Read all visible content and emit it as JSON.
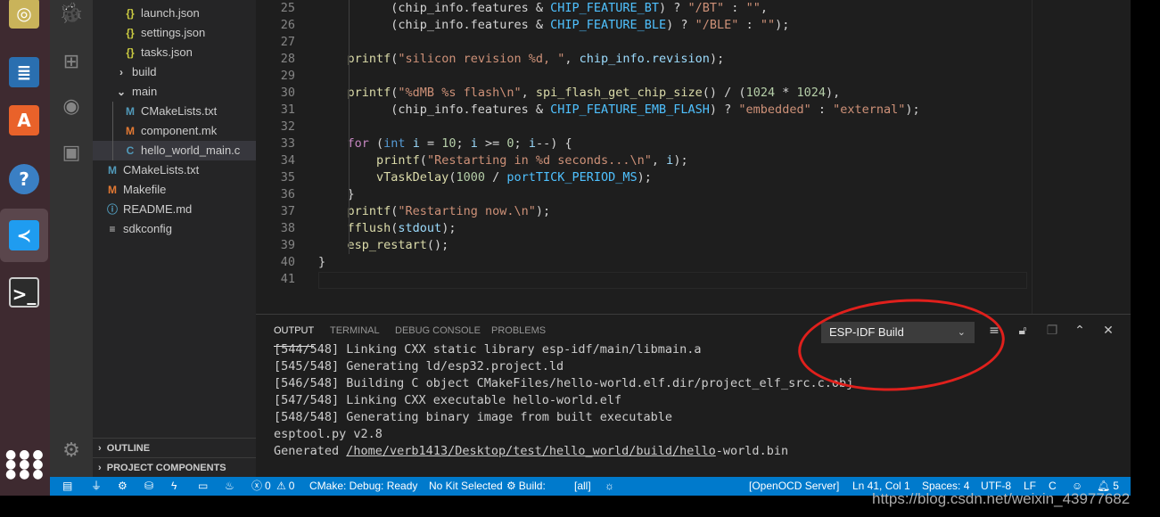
{
  "dock": [
    {
      "name": "rhythmbox-icon",
      "color": "#c9b35a"
    },
    {
      "name": "libreoffice-writer-icon",
      "color": "#2a6fb0"
    },
    {
      "name": "software-center-icon",
      "color": "#e9622a"
    },
    {
      "name": "help-icon",
      "color": "#3a7fc4"
    },
    {
      "name": "vscode-icon",
      "color": "#1f9cf0"
    },
    {
      "name": "terminal-icon",
      "color": "#2c2c2c"
    }
  ],
  "activity": [
    {
      "name": "debug-icon",
      "glyph": "🐞"
    },
    {
      "name": "extensions-icon",
      "glyph": "⊞"
    },
    {
      "name": "espressif-icon",
      "glyph": "◉"
    },
    {
      "name": "remote-explorer-icon",
      "glyph": "▣"
    }
  ],
  "explorer": [
    {
      "label": "launch.json",
      "icon": "{}",
      "color": "#cbcb41",
      "indent": 1
    },
    {
      "label": "settings.json",
      "icon": "{}",
      "color": "#cbcb41",
      "indent": 1
    },
    {
      "label": "tasks.json",
      "icon": "{}",
      "color": "#cbcb41",
      "indent": 1
    },
    {
      "label": "build",
      "icon": "›",
      "color": "#cccccc",
      "indent": 0.5
    },
    {
      "label": "main",
      "icon": "⌄",
      "color": "#cccccc",
      "indent": 0.5
    },
    {
      "label": "CMakeLists.txt",
      "icon": "M",
      "color": "#519aba",
      "indent": 1
    },
    {
      "label": "component.mk",
      "icon": "M",
      "color": "#e37933",
      "indent": 1
    },
    {
      "label": "hello_world_main.c",
      "icon": "C",
      "color": "#519aba",
      "indent": 1,
      "selected": true
    },
    {
      "label": "CMakeLists.txt",
      "icon": "M",
      "color": "#519aba",
      "indent": 0
    },
    {
      "label": "Makefile",
      "icon": "M",
      "color": "#e37933",
      "indent": 0
    },
    {
      "label": "README.md",
      "icon": "ⓘ",
      "color": "#519aba",
      "indent": 0
    },
    {
      "label": "sdkconfig",
      "icon": "≡",
      "color": "#cccccc",
      "indent": 0
    }
  ],
  "sections": {
    "outline": "OUTLINE",
    "project_components": "PROJECT COMPONENTS"
  },
  "editor": {
    "lines": [
      {
        "n": "25",
        "t": [
          [
            "p",
            "          (chip_info.features & "
          ],
          [
            "c",
            "CHIP_FEATURE_BT"
          ],
          [
            "p",
            ") ? "
          ],
          [
            "s",
            "\"/BT\""
          ],
          [
            "p",
            " : "
          ],
          [
            "s",
            "\"\""
          ],
          [
            "p",
            ","
          ]
        ]
      },
      {
        "n": "26",
        "t": [
          [
            "p",
            "          (chip_info.features & "
          ],
          [
            "c",
            "CHIP_FEATURE_BLE"
          ],
          [
            "p",
            ") ? "
          ],
          [
            "s",
            "\"/BLE\""
          ],
          [
            "p",
            " : "
          ],
          [
            "s",
            "\"\""
          ],
          [
            "p",
            ");"
          ]
        ]
      },
      {
        "n": "27",
        "t": []
      },
      {
        "n": "28",
        "t": [
          [
            "f",
            "    printf"
          ],
          [
            "p",
            "("
          ],
          [
            "s",
            "\"silicon revision %d, \""
          ],
          [
            "p",
            ", "
          ],
          [
            "v",
            "chip_info.revision"
          ],
          [
            "p",
            ");"
          ]
        ]
      },
      {
        "n": "29",
        "t": []
      },
      {
        "n": "30",
        "t": [
          [
            "f",
            "    printf"
          ],
          [
            "p",
            "("
          ],
          [
            "s",
            "\"%dMB %s flash\\n\""
          ],
          [
            "p",
            ", "
          ],
          [
            "f",
            "spi_flash_get_chip_size"
          ],
          [
            "p",
            "() / ("
          ],
          [
            "n",
            "1024"
          ],
          [
            "p",
            " * "
          ],
          [
            "n",
            "1024"
          ],
          [
            "p",
            "),"
          ]
        ]
      },
      {
        "n": "31",
        "t": [
          [
            "p",
            "          (chip_info.features & "
          ],
          [
            "c",
            "CHIP_FEATURE_EMB_FLASH"
          ],
          [
            "p",
            ") ? "
          ],
          [
            "s",
            "\"embedded\""
          ],
          [
            "p",
            " : "
          ],
          [
            "s",
            "\"external\""
          ],
          [
            "p",
            ");"
          ]
        ]
      },
      {
        "n": "32",
        "t": []
      },
      {
        "n": "33",
        "t": [
          [
            "k",
            "    for"
          ],
          [
            "p",
            " ("
          ],
          [
            "t",
            "int"
          ],
          [
            "v",
            " i"
          ],
          [
            "p",
            " = "
          ],
          [
            "n",
            "10"
          ],
          [
            "p",
            "; "
          ],
          [
            "v",
            "i"
          ],
          [
            "p",
            " >= "
          ],
          [
            "n",
            "0"
          ],
          [
            "p",
            "; "
          ],
          [
            "v",
            "i"
          ],
          [
            "p",
            "--) {"
          ]
        ]
      },
      {
        "n": "34",
        "t": [
          [
            "f",
            "        printf"
          ],
          [
            "p",
            "("
          ],
          [
            "s",
            "\"Restarting in %d seconds...\\n\""
          ],
          [
            "p",
            ", "
          ],
          [
            "v",
            "i"
          ],
          [
            "p",
            ");"
          ]
        ]
      },
      {
        "n": "35",
        "t": [
          [
            "f",
            "        vTaskDelay"
          ],
          [
            "p",
            "("
          ],
          [
            "n",
            "1000"
          ],
          [
            "p",
            " / "
          ],
          [
            "c",
            "portTICK_PERIOD_MS"
          ],
          [
            "p",
            ");"
          ]
        ]
      },
      {
        "n": "36",
        "t": [
          [
            "p",
            "    }"
          ]
        ]
      },
      {
        "n": "37",
        "t": [
          [
            "f",
            "    printf"
          ],
          [
            "p",
            "("
          ],
          [
            "s",
            "\"Restarting now.\\n\""
          ],
          [
            "p",
            ");"
          ]
        ]
      },
      {
        "n": "38",
        "t": [
          [
            "f",
            "    fflush"
          ],
          [
            "p",
            "("
          ],
          [
            "v",
            "stdout"
          ],
          [
            "p",
            ");"
          ]
        ]
      },
      {
        "n": "39",
        "t": [
          [
            "f",
            "    esp_restart"
          ],
          [
            "p",
            "();"
          ]
        ]
      },
      {
        "n": "40",
        "t": [
          [
            "p",
            "}"
          ]
        ]
      },
      {
        "n": "41",
        "t": []
      }
    ]
  },
  "colors": {
    "p": "#d4d4d4",
    "v": "#9cdcfe",
    "c": "#4fc1ff",
    "s": "#ce9178",
    "f": "#dcdcaa",
    "k": "#c586c0",
    "t": "#569cd6",
    "n": "#b5cea8"
  },
  "panel": {
    "tabs": [
      "OUTPUT",
      "TERMINAL",
      "DEBUG CONSOLE",
      "PROBLEMS"
    ],
    "channel": "ESP-IDF Build",
    "output": [
      "[544/548] Linking CXX static library esp-idf/main/libmain.a",
      "[545/548] Generating ld/esp32.project.ld",
      "[546/548] Building C object CMakeFiles/hello-world.elf.dir/project_elf_src.c.obj",
      "[547/548] Linking CXX executable hello-world.elf",
      "[548/548] Generating binary image from built executable",
      "esptool.py v2.8"
    ],
    "generated_prefix": "Generated ",
    "generated_link": "/home/verb1413/Desktop/test/hello_world/build/hello",
    "generated_suffix": "-world.bin"
  },
  "status": {
    "errors": "0",
    "warnings": "0",
    "cmake": "CMake: Debug: Ready",
    "kit": "No Kit Selected",
    "build": "Build:",
    "target": "[all]",
    "openocd": "[OpenOCD Server]",
    "position": "Ln 41, Col 1",
    "spaces": "Spaces: 4",
    "encoding": "UTF-8",
    "eol": "LF",
    "language": "C",
    "notifications": "5"
  },
  "watermark": "https://blog.csdn.net/weixin_43977682"
}
